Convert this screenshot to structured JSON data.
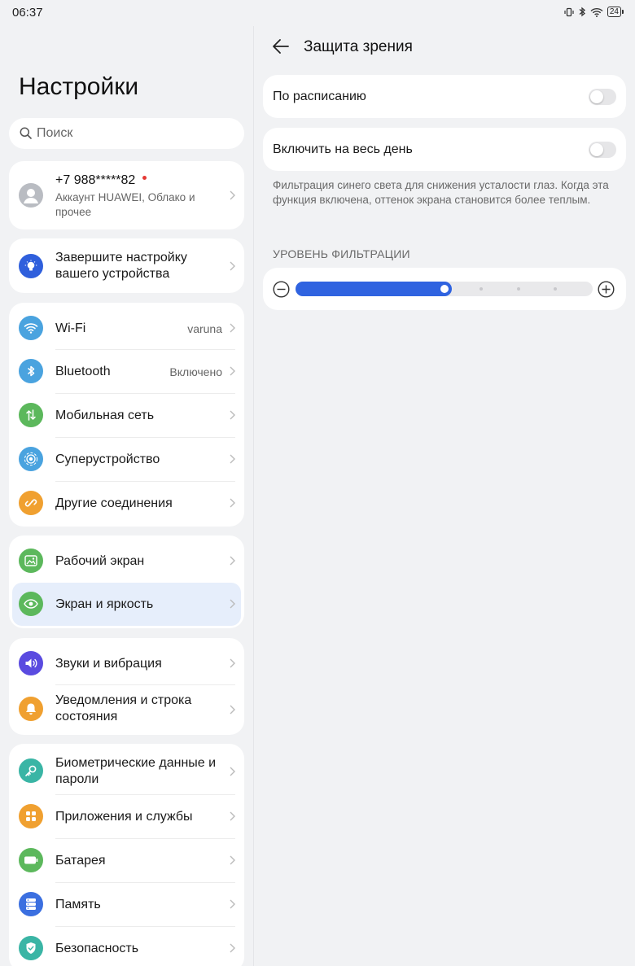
{
  "status_bar": {
    "time": "06:37",
    "battery_level": "24"
  },
  "left": {
    "title": "Настройки",
    "search": {
      "placeholder": "Поиск"
    },
    "account": {
      "title": "+7 988*****82",
      "subtitle": "Аккаунт HUAWEI, Облако и прочее"
    },
    "setup": {
      "label": "Завершите настройку вашего устройства"
    },
    "connections": {
      "wifi": {
        "label": "Wi-Fi",
        "value": "varuna"
      },
      "bluetooth": {
        "label": "Bluetooth",
        "value": "Включено"
      },
      "mobile": {
        "label": "Мобильная сеть"
      },
      "superdevice": {
        "label": "Суперустройство"
      },
      "other": {
        "label": "Другие соединения"
      }
    },
    "display": {
      "home": {
        "label": "Рабочий экран"
      },
      "screen": {
        "label": "Экран и яркость"
      }
    },
    "sound": {
      "sounds": {
        "label": "Звуки и вибрация"
      },
      "notifications": {
        "label": "Уведомления и строка состояния"
      }
    },
    "system": {
      "biometrics": {
        "label": "Биометрические данные и пароли"
      },
      "apps": {
        "label": "Приложения и службы"
      },
      "battery": {
        "label": "Батарея"
      },
      "storage": {
        "label": "Память"
      },
      "security": {
        "label": "Безопасность"
      }
    }
  },
  "right": {
    "title": "Защита зрения",
    "schedule": {
      "label": "По расписанию",
      "on": false
    },
    "all_day": {
      "label": "Включить на весь день",
      "on": false
    },
    "description": "Фильтрация синего света для снижения усталости глаз. Когда эта функция включена, оттенок экрана становится более теплым.",
    "filter_section": "УРОВЕНЬ ФИЛЬТРАЦИИ",
    "filter_level": {
      "value": 0.5,
      "steps": 8
    }
  },
  "colors": {
    "accent": "#2f63e0",
    "wifi_icon": "#4aa3df",
    "bluetooth_icon": "#4aa3df",
    "mobile_icon": "#5cb85c",
    "superdevice_icon": "#4aa3df",
    "other_icon": "#f0a030",
    "home_icon": "#5cb85c",
    "screen_icon": "#5cb85c",
    "sounds_icon": "#5a4be0",
    "notifications_icon": "#f0a030",
    "biometrics_icon": "#3ab5a5",
    "apps_icon": "#f0a030",
    "battery_icon": "#5cb85c",
    "storage_icon": "#3b6fe0",
    "security_icon": "#3ab5a5"
  }
}
